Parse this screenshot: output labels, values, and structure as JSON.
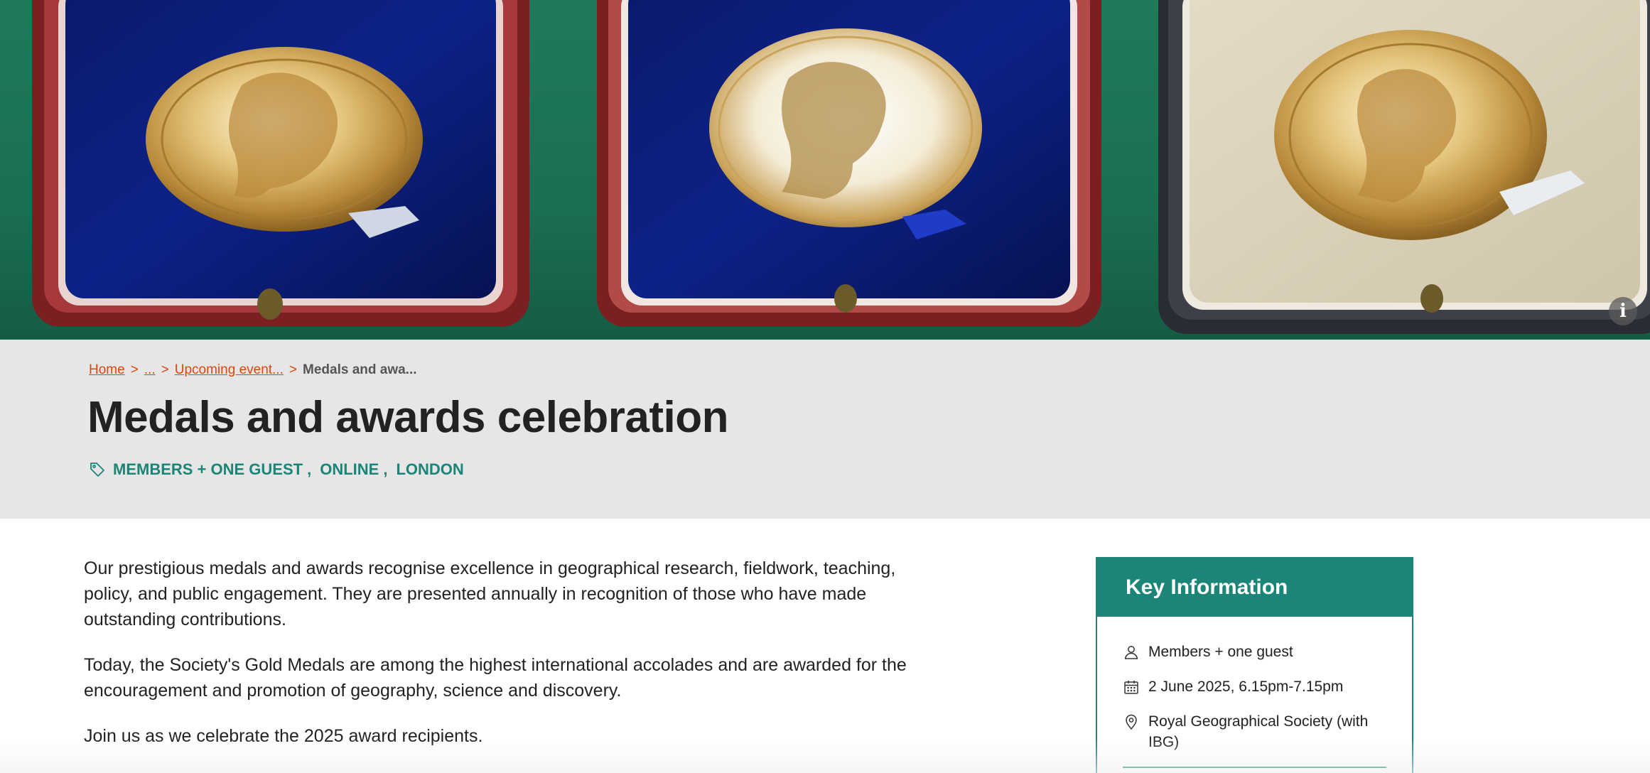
{
  "hero": {
    "info_button": "i",
    "image_description_icon": "medals-photo"
  },
  "breadcrumb": {
    "home": "Home",
    "ellipsis": "...",
    "upcoming": "Upcoming event...",
    "current": "Medals and awa...",
    "separator": ">"
  },
  "page": {
    "title": "Medals and awards celebration",
    "tags": [
      "MEMBERS + ONE GUEST",
      "ONLINE",
      "LONDON"
    ]
  },
  "content": {
    "paragraphs": [
      "Our prestigious medals and awards recognise excellence in geographical research, fieldwork, teaching, policy, and public engagement. They are presented annually in recognition of those who have made outstanding contributions.",
      "Today, the Society's Gold Medals are among the highest international accolades and are awarded for the encouragement and promotion of geography, science and discovery.",
      "Join us as we celebrate the 2025 award recipients."
    ]
  },
  "key_info": {
    "heading": "Key Information",
    "audience": "Members + one guest",
    "date": "2 June 2025, 6.15pm-7.15pm",
    "venue": "Royal Geographical Society (with IBG)"
  },
  "colors": {
    "accent": "#1b8577",
    "link": "#d9480f",
    "band": "#e6e6e6"
  }
}
